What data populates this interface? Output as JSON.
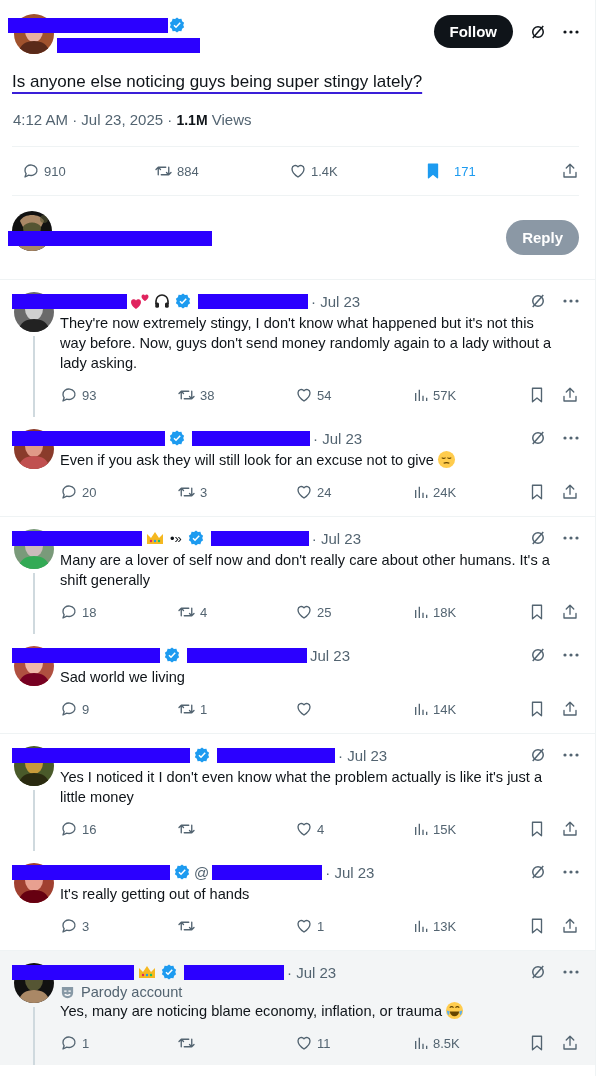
{
  "main_post": {
    "follow_button": "Follow",
    "text": "Is anyone else noticing guys being super stingy lately?",
    "meta": "4:12 AM · Jul 23, 2025 · **1.1M** Views",
    "stats": {
      "replies": "910",
      "reposts": "884",
      "likes": "1.4K",
      "bookmarks": "171"
    },
    "bookmarked": true
  },
  "composer": {
    "reply_button": "Reply",
    "disabled": true
  },
  "replies": [
    {
      "name_extras": [
        {
          "kind": "hearts"
        },
        {
          "kind": "headphones"
        }
      ],
      "date": "· Jul 23",
      "text": "They're now extremely stingy, I don't know what happened but it's not this way before. Now, guys don't send money randomly again to a lady without a lady asking.",
      "replies": "93",
      "reposts": "38",
      "likes": "54",
      "views": "57K",
      "bookmarked": false,
      "thread_line": true,
      "highlighted": false
    },
    {
      "date": "· Jul 23",
      "text": "Even if you ask they will still look for an excuse not to give",
      "emoji": {
        "kind": "pensive"
      },
      "replies": "20",
      "reposts": "3",
      "likes": "24",
      "views": "24K",
      "bookmarked": false,
      "thread_line": false,
      "highlighted": false
    },
    {
      "name_extras": [
        {
          "kind": "crown"
        },
        {
          "kind": "text",
          "text": "•»"
        }
      ],
      "date": "· Jul 23",
      "text": "Many are a lover of self now and don't really care about other humans. It's a shift generally",
      "replies": "18",
      "reposts": "4",
      "likes": "25",
      "views": "18K",
      "bookmarked": false,
      "thread_line": true,
      "highlighted": false
    },
    {
      "date": "Jul 23",
      "text": "Sad world we living",
      "replies": "9",
      "reposts": "1",
      "views": "14K",
      "bookmarked": false,
      "thread_line": false,
      "highlighted": false
    },
    {
      "date": "· Jul 23",
      "text": "Yes I noticed it I don't even know what the problem actually is like it's just a little money",
      "replies": "16",
      "likes": "4",
      "views": "15K",
      "bookmarked": false,
      "thread_line": true,
      "highlighted": false
    },
    {
      "handle_prefix": "@",
      "date": "· Jul 23",
      "text": "It's really getting out of hands",
      "replies": "3",
      "likes": "1",
      "views": "13K",
      "bookmarked": false,
      "thread_line": false,
      "highlighted": false
    },
    {
      "name_extras": [
        {
          "kind": "crown"
        }
      ],
      "date": "· Jul 23",
      "parody_label": "Parody account",
      "text": "Yes, many are noticing blame economy, inflation, or trauma",
      "emoji": {
        "kind": "laughing"
      },
      "replies": "1",
      "likes": "11",
      "views": "8.5K",
      "bookmarked": false,
      "thread_line": true,
      "highlighted": true
    }
  ]
}
